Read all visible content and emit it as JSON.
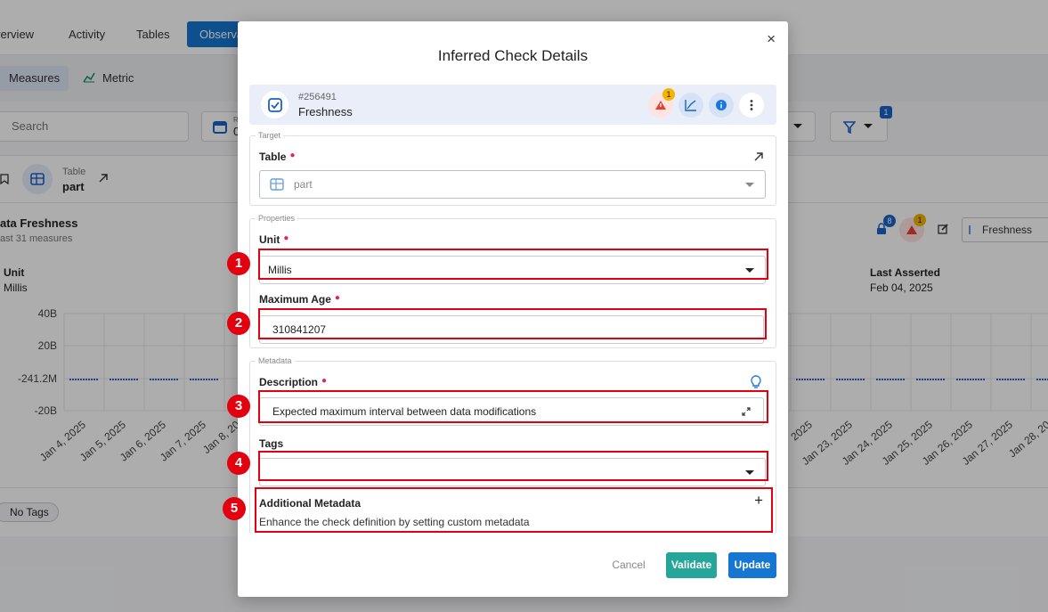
{
  "background": {
    "tabs": [
      "verview",
      "Activity",
      "Tables",
      "Observa"
    ],
    "subtabs": [
      "Measures",
      "Metric"
    ],
    "search_placeholder": "Search",
    "date_partial": "R",
    "date_value_partial": "0",
    "filter_badge": "1",
    "table_caption": "Table",
    "table_name": "part",
    "section_title": "ata Freshness",
    "section_subtitle": "ast 31 measures",
    "unit_label": "Unit",
    "unit_value": "Millis",
    "last_asserted_label": "Last Asserted",
    "last_asserted_value": "Feb 04, 2025",
    "anomaly_badge": "8",
    "warning_badge": "1",
    "freshness_chip": "Freshness",
    "no_tags": "No Tags",
    "chart_data": {
      "type": "line",
      "yticks": [
        "40B",
        "20B",
        "-241.2M",
        "-20B"
      ],
      "xticks_left": [
        "Jan 4, 2025",
        "Jan 5, 2025",
        "Jan 6, 2025",
        "Jan 7, 2025",
        "Jan 8, 20"
      ],
      "xticks_right": [
        "2025",
        "Jan 23, 2025",
        "Jan 24, 2025",
        "Jan 25, 2025",
        "Jan 26, 2025",
        "Jan 27, 2025",
        "Jan 28, 20"
      ]
    }
  },
  "modal": {
    "title": "Inferred Check Details",
    "close_label": "×",
    "check_id": "#256491",
    "check_name": "Freshness",
    "warning_count": "1",
    "target_legend": "Target",
    "table_label": "Table",
    "table_value": "part",
    "properties_legend": "Properties",
    "unit_label": "Unit",
    "unit_value": "Millis",
    "max_age_label": "Maximum Age",
    "max_age_value": "310841207",
    "metadata_legend": "Metadata",
    "description_label": "Description",
    "description_value": "Expected maximum interval between data modifications",
    "tags_label": "Tags",
    "tags_value": "",
    "additional_label": "Additional Metadata",
    "additional_hint": "Enhance the check definition by setting custom metadata",
    "plus": "+",
    "cancel": "Cancel",
    "validate": "Validate",
    "update": "Update",
    "markers": [
      "1",
      "2",
      "3",
      "4",
      "5"
    ]
  },
  "colors": {
    "primary": "#1677d2",
    "validate": "#26a69a",
    "annotation": "#e3000f",
    "required": "#e0245e"
  }
}
